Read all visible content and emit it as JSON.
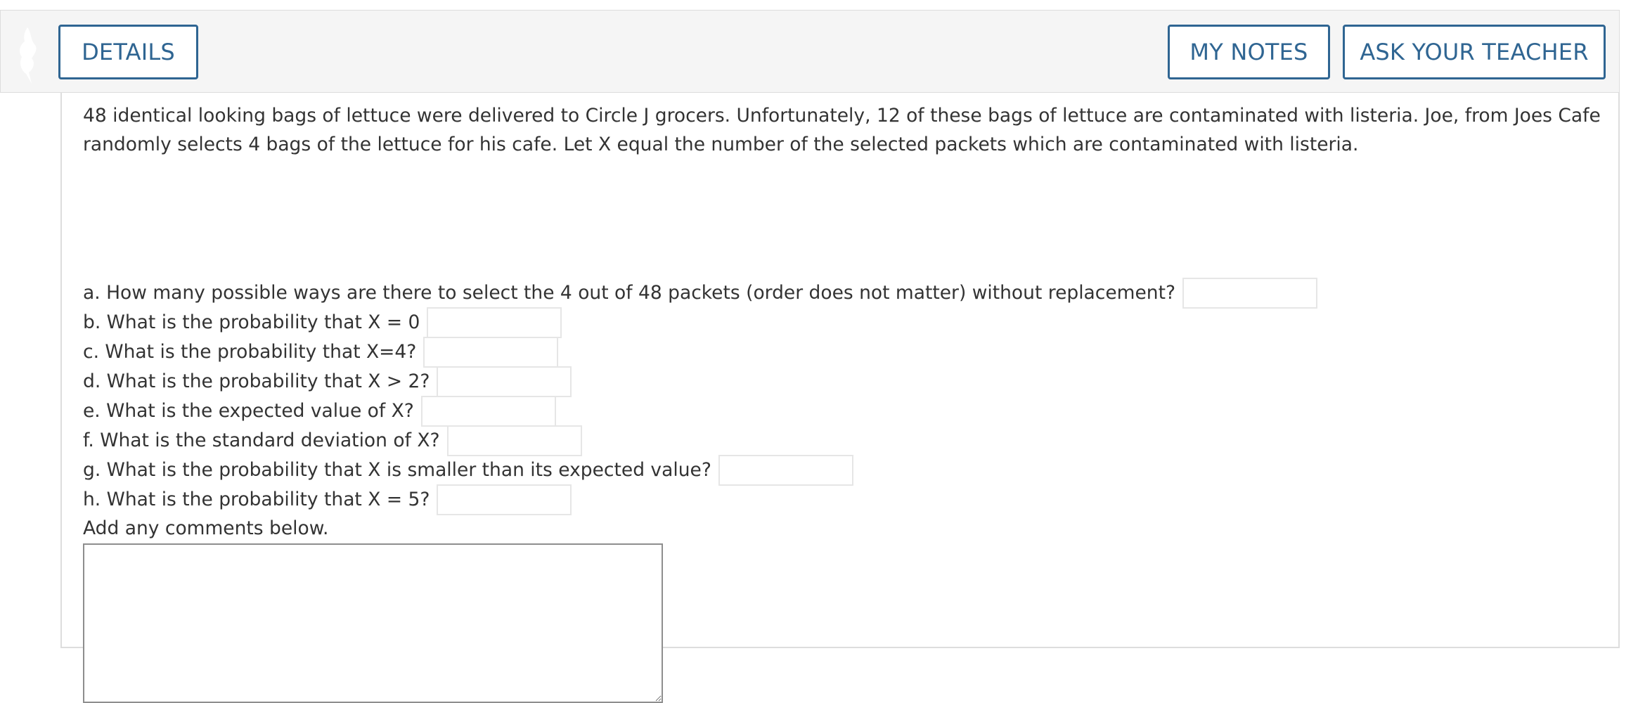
{
  "header": {
    "details_label": "DETAILS",
    "my_notes_label": "MY NOTES",
    "ask_teacher_label": "ASK YOUR TEACHER"
  },
  "problem": {
    "intro": "48 identical looking bags of lettuce were delivered to Circle J grocers. Unfortunately, 12 of these bags of lettuce are contaminated with listeria. Joe, from Joes Cafe randomly selects 4 bags of the lettuce for his cafe. Let X equal the number of the selected packets which are contaminated with listeria.",
    "questions": [
      {
        "text": "a. How many possible ways are there to select the 4 out of 48 packets (order does not matter) without replacement?",
        "value": ""
      },
      {
        "text": "b. What is the probability that X = 0",
        "value": ""
      },
      {
        "text": "c. What is the probability that X=4?",
        "value": ""
      },
      {
        "text": "d. What is the probability that X > 2?",
        "value": ""
      },
      {
        "text": "e. What is the expected value of X?",
        "value": ""
      },
      {
        "text": "f. What is the standard deviation of X?",
        "value": ""
      },
      {
        "text": "g. What is the probability that X is smaller than its expected value?",
        "value": ""
      },
      {
        "text": "h. What is the probability that X = 5?",
        "value": ""
      }
    ],
    "comments_label": "Add any comments below.",
    "comments_value": ""
  },
  "colors": {
    "accent": "#2f6592",
    "header_bg": "#f5f5f5",
    "border": "#dddddd",
    "text": "#333333"
  },
  "icons": {
    "logo": "bird-logo-icon"
  }
}
